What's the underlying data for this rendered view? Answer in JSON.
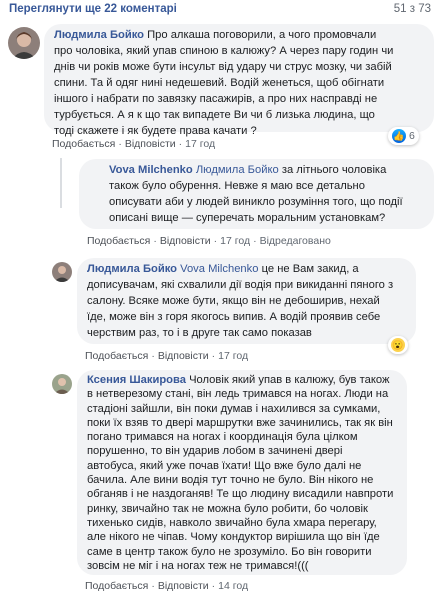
{
  "header": {
    "more_comments": "Переглянути ще 22 коментарі",
    "page_count": "51 з 73"
  },
  "comments": [
    {
      "author": "Людмила Бойко",
      "lines": [
        " Про алкаша поговорили, а чого промовчали",
        "про чоловіка, який упав спиною в калюжу? А через пару годин чи",
        "днів чи років може бути інсульт від удару чи струс мозку, чи забій",
        "спини. Та й одяг нині недешевий. Водій женеться, щоб обігнати",
        "іншого і набрати по завязку пасажирів, а про них насправді не",
        "турбується. А я к що так випадете Ви чи б лизька людина, що",
        "тоді скажете і як будете права качати ?"
      ],
      "like": "Подобається",
      "reply": "Відповісти",
      "time": "17 год",
      "reaction_count": "6",
      "reaction": "like-icon"
    },
    {
      "author": "Vova Milchenko",
      "mention": "Людмила Бойко",
      "lines": [
        " за літнього чоловіка",
        "також було обурення. Невже я маю все детально",
        "описувати аби у людей виникло розуміння того, що події",
        "описані вище — суперечать моральним установкам?"
      ],
      "like": "Подобається",
      "reply": "Відповісти",
      "time": "17 год",
      "edited": "Відредаговано"
    },
    {
      "author": "Людмила Бойко",
      "mention": "Vova Milchenko",
      "lines": [
        " це не Вам закид, а",
        "дописувачам, які схвалили дії водія при викиданні пяного з",
        "салону. Всяке може бути, якщо він не дебоширив, нехай",
        "їде, може він з горя якогось випив. А водій проявив себе",
        "черствим раз, то і в друге так само показав"
      ],
      "like": "Подобається",
      "reply": "Відповісти",
      "time": "17 год",
      "reaction": "wow-icon"
    },
    {
      "author": "Ксения Шакирова",
      "lines": [
        " Чоловік який упав в калюжу, був також",
        "в нетверезому стані, він ледь тримався на ногах. Люди на",
        "стадіоні зайшли, він поки думав і нахилився за сумками,",
        "поки їх взяв то двері маршрутки вже зачинились, так як він",
        "погано тримався на ногах і координація була цілком",
        "порушенно, то він ударив лобом в зачинені двері",
        "автобуса, який уже почав їхати! Що вже було далі не",
        "бачила. Але вини водія тут точно не було. Він нікого не",
        "обганяв і не наздоганяв! Те що людину висадили навпроти",
        "ринку, звичайно так не можна було робити, бо чоловік",
        "тихенько сидів, навколо звичайно була хмара перегару,",
        "але нікого не чіпав. Чому кондуктор вирішила що він їде",
        "саме в центр також було не зрозуміло. Бо він говорити",
        "зовсім не міг і на ногах теж не тримався!((("
      ],
      "like": "Подобається",
      "reply": "Відповісти",
      "time": "14 год"
    }
  ],
  "colors": {
    "link": "#385898",
    "bubble": "#f2f3f5",
    "meta": "#606770",
    "like_blue": "#1877f2",
    "wow_yellow": "#fcd24c"
  }
}
